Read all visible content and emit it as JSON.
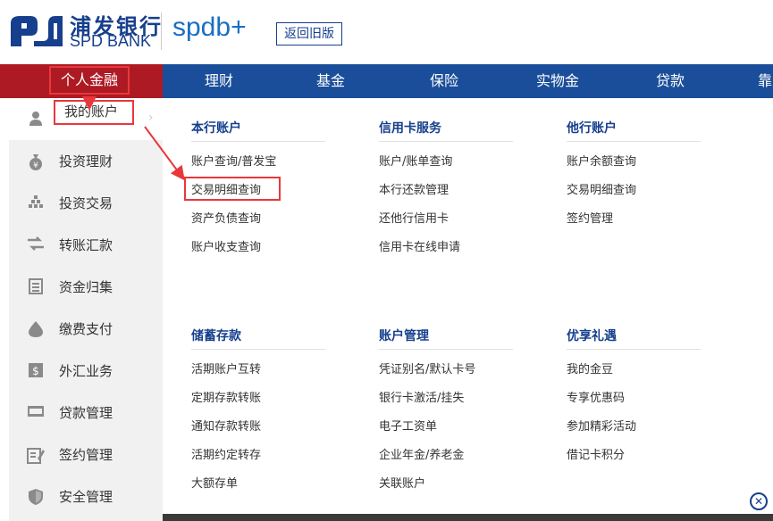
{
  "header": {
    "logo_cn": "浦发银行",
    "logo_en": "SPD BANK",
    "product_brand": "spdb",
    "return_old_label": "返回旧版"
  },
  "nav": {
    "personal_label": "个人金融",
    "items": [
      "理财",
      "基金",
      "保险",
      "实物金",
      "贷款",
      "靠"
    ]
  },
  "side_menu": {
    "items": [
      {
        "label": "我的账户",
        "icon": "user-icon"
      },
      {
        "label": "投资理财",
        "icon": "money-bag-icon"
      },
      {
        "label": "投资交易",
        "icon": "pyramid-icon"
      },
      {
        "label": "转账汇款",
        "icon": "transfer-icon"
      },
      {
        "label": "资金归集",
        "icon": "ledger-icon"
      },
      {
        "label": "缴费支付",
        "icon": "drop-icon"
      },
      {
        "label": "外汇业务",
        "icon": "currency-icon"
      },
      {
        "label": "贷款管理",
        "icon": "loan-icon"
      },
      {
        "label": "签约管理",
        "icon": "sign-icon"
      },
      {
        "label": "安全管理",
        "icon": "shield-icon"
      }
    ]
  },
  "sections": {
    "local_account": {
      "title": "本行账户",
      "links": [
        "账户查询/普发宝",
        "交易明细查询",
        "资产负债查询",
        "账户收支查询"
      ]
    },
    "credit_card": {
      "title": "信用卡服务",
      "links": [
        "账户/账单查询",
        "本行还款管理",
        "还他行信用卡",
        "信用卡在线申请"
      ]
    },
    "other_account": {
      "title": "他行账户",
      "links": [
        "账户余额查询",
        "交易明细查询",
        "签约管理"
      ]
    },
    "savings": {
      "title": "储蓄存款",
      "links": [
        "活期账户互转",
        "定期存款转账",
        "通知存款转账",
        "活期约定转存",
        "大额存单"
      ]
    },
    "account_mgmt": {
      "title": "账户管理",
      "links": [
        "凭证别名/默认卡号",
        "银行卡激活/挂失",
        "电子工资单",
        "企业年金/养老金",
        "关联账户"
      ]
    },
    "rewards": {
      "title": "优享礼遇",
      "links": [
        "我的金豆",
        "专享优惠码",
        "参加精彩活动",
        "借记卡积分"
      ]
    }
  },
  "colors": {
    "nav_blue": "#1a4e9a",
    "nav_red": "#ae1a23",
    "title_blue": "#163f8d",
    "highlight_red": "#e9373c"
  }
}
